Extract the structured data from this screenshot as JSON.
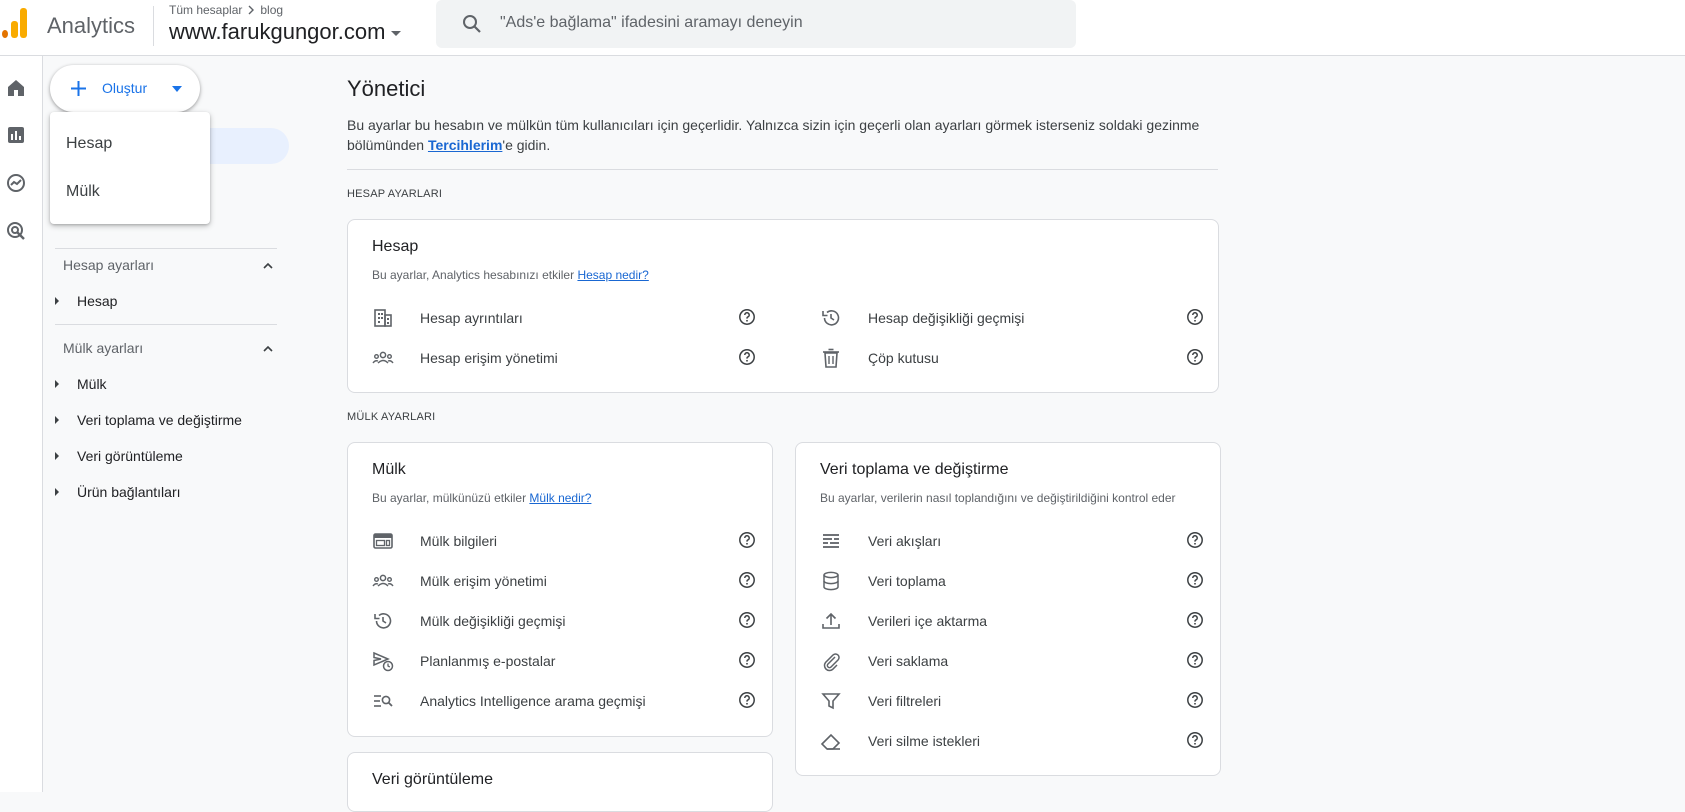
{
  "header": {
    "app_name": "Analytics",
    "breadcrumb_root": "Tüm hesaplar",
    "breadcrumb_child": "blog",
    "property_name": "www.farukgungor.com",
    "search_placeholder": "\"Ads'e bağlama\" ifadesini aramayı deneyin"
  },
  "rail": {
    "icons": [
      "home-icon",
      "reports-icon",
      "explore-icon",
      "advertising-icon"
    ]
  },
  "nav": {
    "create_label": "Oluştur",
    "create_menu": [
      "Hesap",
      "Mülk"
    ],
    "account_section": "Hesap ayarları",
    "account_items": [
      "Hesap"
    ],
    "property_section": "Mülk ayarları",
    "property_items": [
      "Mülk",
      "Veri toplama ve değiştirme",
      "Veri görüntüleme",
      "Ürün bağlantıları"
    ]
  },
  "main": {
    "title": "Yönetici",
    "description_part1": "Bu ayarlar bu hesabın ve mülkün tüm kullanıcıları için geçerlidir. Yalnızca sizin için geçerli olan ayarları görmek isterseniz soldaki gezinme bölümünden ",
    "description_link": "Tercihlerim",
    "description_part2": "'e gidin.",
    "account_group_label": "HESAP AYARLARI",
    "property_group_label": "MÜLK AYARLARI"
  },
  "account_card": {
    "title": "Hesap",
    "subtitle": "Bu ayarlar, Analytics hesabınızı etkiler ",
    "subtitle_link": "Hesap nedir?",
    "left_rows": [
      {
        "label": "Hesap ayrıntıları",
        "icon": "building-icon"
      },
      {
        "label": "Hesap erişim yönetimi",
        "icon": "people-icon"
      }
    ],
    "right_rows": [
      {
        "label": "Hesap değişikliği geçmişi",
        "icon": "history-icon"
      },
      {
        "label": "Çöp kutusu",
        "icon": "trash-icon"
      }
    ]
  },
  "property_card": {
    "title": "Mülk",
    "subtitle": "Bu ayarlar, mülkünüzü etkiler ",
    "subtitle_link": "Mülk nedir?",
    "rows": [
      {
        "label": "Mülk bilgileri",
        "icon": "web-icon"
      },
      {
        "label": "Mülk erişim yönetimi",
        "icon": "people-icon"
      },
      {
        "label": "Mülk değişikliği geçmişi",
        "icon": "history-icon"
      },
      {
        "label": "Planlanmış e-postalar",
        "icon": "schedule-send-icon"
      },
      {
        "label": "Analytics Intelligence arama geçmişi",
        "icon": "manage-search-icon"
      }
    ]
  },
  "data_card": {
    "title": "Veri toplama ve değiştirme",
    "subtitle": "Bu ayarlar, verilerin nasıl toplandığını ve değiştirildiğini kontrol eder",
    "rows": [
      {
        "label": "Veri akışları",
        "icon": "streams-icon"
      },
      {
        "label": "Veri toplama",
        "icon": "database-icon"
      },
      {
        "label": "Verileri içe aktarma",
        "icon": "upload-icon"
      },
      {
        "label": "Veri saklama",
        "icon": "attachment-icon"
      },
      {
        "label": "Veri filtreleri",
        "icon": "filter-icon"
      },
      {
        "label": "Veri silme istekleri",
        "icon": "eraser-icon"
      }
    ]
  },
  "display_card": {
    "title": "Veri görüntüleme"
  },
  "colors": {
    "accent": "#1a73e8",
    "logo_orange": "#f9ab00",
    "logo_dark_orange": "#e37400"
  }
}
